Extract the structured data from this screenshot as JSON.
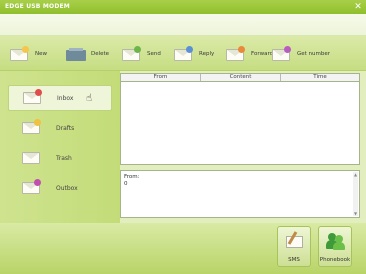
{
  "window": {
    "title": "EDGE USB MODEM",
    "close_glyph": "✕"
  },
  "toolbar": {
    "new": "New",
    "delete": "Delete",
    "send": "Send",
    "reply": "Reply",
    "forward": "Forward",
    "get_number": "Get number"
  },
  "sidebar": {
    "items": [
      {
        "label": "Inbox",
        "active": true
      },
      {
        "label": "Drafts",
        "active": false
      },
      {
        "label": "Trash",
        "active": false
      },
      {
        "label": "Outbox",
        "active": false
      }
    ]
  },
  "table": {
    "headers": [
      "From",
      "Content",
      "Time"
    ]
  },
  "detail": {
    "line1": "From:",
    "line2": "0"
  },
  "bottom": {
    "sms": "SMS",
    "phonebook": "Phonebook"
  },
  "colors": {
    "accent": "#8fbf2c",
    "panel": "#c6dd82",
    "background": "#e9f2cf"
  }
}
